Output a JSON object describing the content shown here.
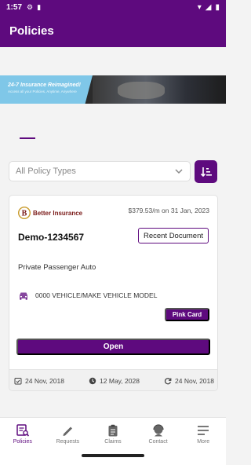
{
  "status_bar": {
    "time": "1:57"
  },
  "app_bar": {
    "title": "Policies"
  },
  "banner": {
    "headline": "24-7 Insurance Reimagined!",
    "subtext": "Access all your Policies, Anytime, Anywhere"
  },
  "filter": {
    "selected": "All Policy Types"
  },
  "policy_card": {
    "insurer_name": "Better Insurance",
    "premium": "$379.53/m on 31 Jan, 2023",
    "policy_number": "Demo-1234567",
    "recent_document_label": "Recent Document",
    "policy_type": "Private Passenger Auto",
    "vehicle": "0000 VEHICLE/MAKE VEHICLE MODEL",
    "pink_card_label": "Pink Card",
    "open_label": "Open",
    "dates": {
      "start": "24 Nov, 2018",
      "expiry": "12 May, 2028",
      "renewal": "24 Nov, 2018"
    }
  },
  "bottom_nav": {
    "policies": "Policies",
    "requests": "Requests",
    "claims": "Claims",
    "contact": "Contact",
    "more": "More"
  },
  "colors": {
    "brand": "#5e0a7e",
    "banner_blue": "#7fc7e8"
  }
}
